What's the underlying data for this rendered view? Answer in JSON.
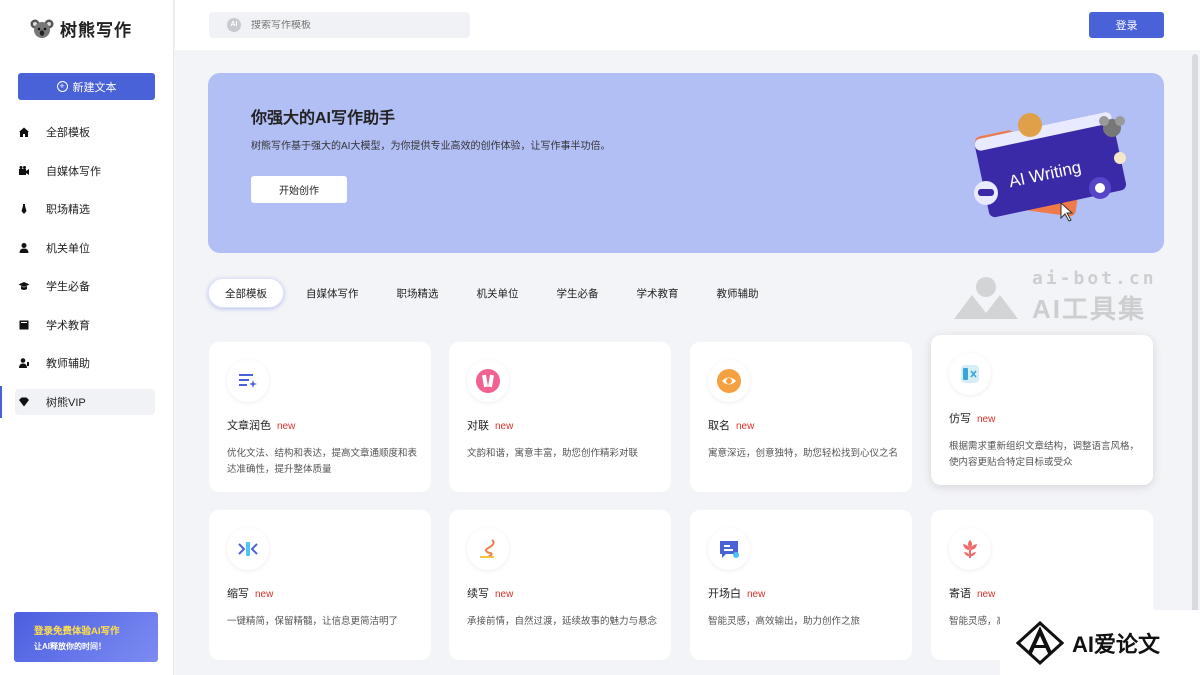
{
  "app": {
    "name": "树熊写作"
  },
  "sidebar": {
    "new_text": "新建文本",
    "items": [
      {
        "label": "全部模板",
        "icon": "home-icon"
      },
      {
        "label": "自媒体写作",
        "icon": "video-icon"
      },
      {
        "label": "职场精选",
        "icon": "tie-icon"
      },
      {
        "label": "机关单位",
        "icon": "person-icon"
      },
      {
        "label": "学生必备",
        "icon": "student-cap-icon"
      },
      {
        "label": "学术教育",
        "icon": "book-icon"
      },
      {
        "label": "教师辅助",
        "icon": "teacher-icon"
      },
      {
        "label": "树熊VIP",
        "icon": "diamond-icon"
      }
    ],
    "promo": {
      "line1": "登录免费体验AI写作",
      "line2": "让AI释放你的时间！"
    }
  },
  "header": {
    "search_placeholder": "搜索写作模板",
    "login": "登录"
  },
  "hero": {
    "title": "你强大的AI写作助手",
    "subtitle": "树熊写作基于强大的AI大模型，为你提供专业高效的创作体验，让写作事半功倍。",
    "button": "开始创作",
    "illustration_text": "AI Writing"
  },
  "tabs": [
    "全部模板",
    "自媒体写作",
    "职场精选",
    "机关单位",
    "学生必备",
    "学术教育",
    "教师辅助"
  ],
  "cards": [
    {
      "title": "文章润色",
      "badge": "new",
      "desc": "优化文法、结构和表达，提高文章通顺度和表达准确性，提升整体质量",
      "icon": "polish-icon"
    },
    {
      "title": "对联",
      "badge": "new",
      "desc": "文韵和谐，寓意丰富，助您创作精彩对联",
      "icon": "couplet-icon"
    },
    {
      "title": "取名",
      "badge": "new",
      "desc": "寓意深远，创意独特，助您轻松找到心仪之名",
      "icon": "naming-icon"
    },
    {
      "title": "仿写",
      "badge": "new",
      "desc": "根据需求重新组织文章结构，调整语言风格，使内容更贴合特定目标或受众",
      "icon": "imitate-icon"
    },
    {
      "title": "缩写",
      "badge": "new",
      "desc": "一键精简，保留精髓，让信息更简洁明了",
      "icon": "abbreviate-icon"
    },
    {
      "title": "续写",
      "badge": "new",
      "desc": "承接前情，自然过渡，延续故事的魅力与悬念",
      "icon": "continue-icon"
    },
    {
      "title": "开场白",
      "badge": "new",
      "desc": "智能灵感，高效输出，助力创作之旅",
      "icon": "opening-icon"
    },
    {
      "title": "寄语",
      "badge": "new",
      "desc": "智能灵感，高",
      "icon": "flower-icon"
    }
  ],
  "watermarks": {
    "site": "ai-bot.cn",
    "tool": "AI工具集",
    "brand": "AI爱论文"
  },
  "colors": {
    "primary": "#4a62d8",
    "hero_bg": "#b2bff5",
    "new_badge": "#e0302a"
  }
}
